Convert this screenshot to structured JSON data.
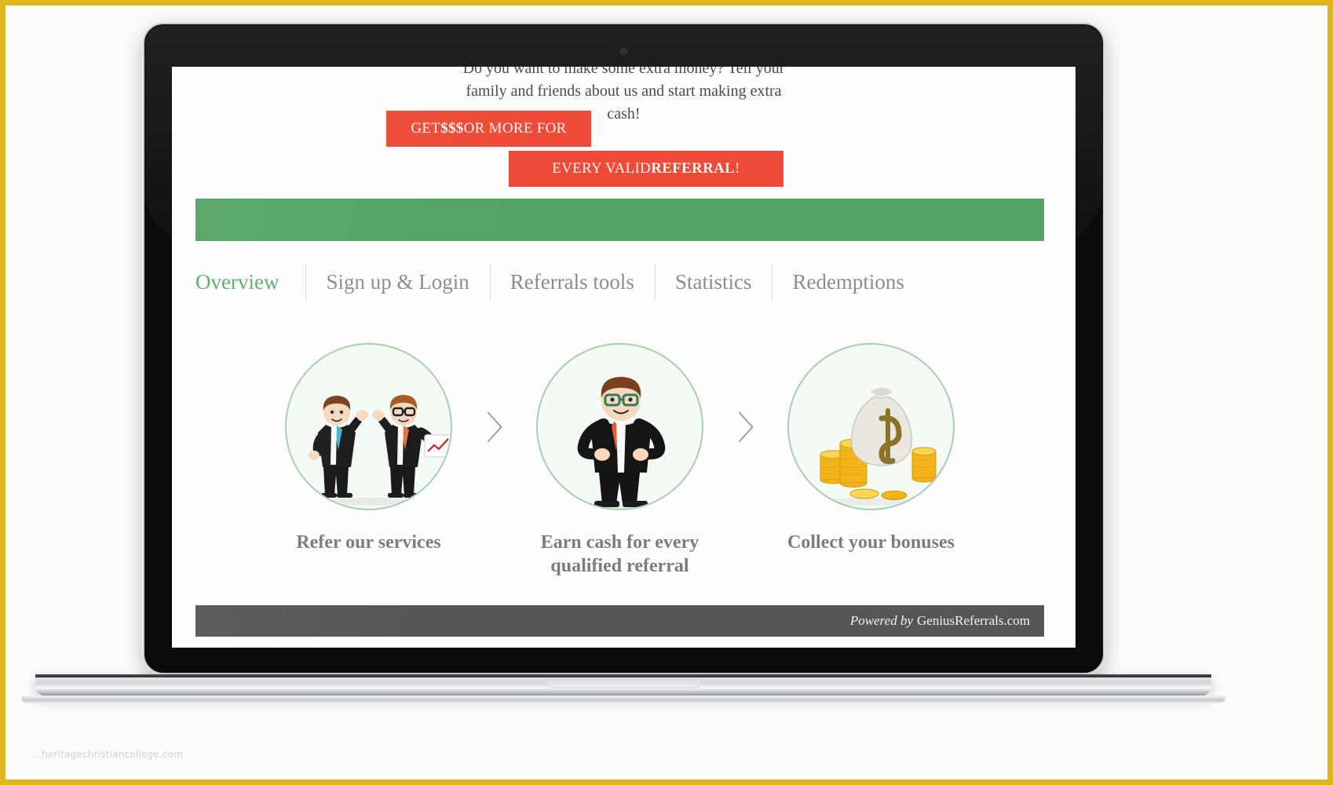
{
  "page": {
    "watermark": "...heritagechristiancollege.com",
    "border_color": "#e0b61e"
  },
  "intro": {
    "text": "Do you want to make some extra money? Tell your family and friends about us and start making extra cash!"
  },
  "ribbon": {
    "color": "#ee4a37",
    "fold_color": "#2e3033",
    "line1_prefix": "GET ",
    "line1_strong": "$$$",
    "line1_suffix": " OR MORE FOR",
    "line2_prefix": "EVERY VALID ",
    "line2_strong": "REFERRAL",
    "line2_suffix": "!"
  },
  "greenbar": {
    "color": "#55a365"
  },
  "tabs": {
    "active_color": "#5aad6b",
    "items": [
      {
        "label": "Overview",
        "active": true
      },
      {
        "label": "Sign up & Login",
        "active": false
      },
      {
        "label": "Referrals tools",
        "active": false
      },
      {
        "label": "Statistics",
        "active": false
      },
      {
        "label": "Redemptions",
        "active": false
      }
    ]
  },
  "steps": [
    {
      "icon": "two-businessmen-high-five-icon",
      "caption": "Refer our services"
    },
    {
      "icon": "confident-businessman-icon",
      "caption": "Earn cash for every qualified referral"
    },
    {
      "icon": "money-bag-and-coins-icon",
      "caption": "Collect your bonuses"
    }
  ],
  "separator": {
    "icon": "chevron-right-icon",
    "color": "#8aa694"
  },
  "footer": {
    "powered_by": "Powered by",
    "brand": "GeniusReferrals.com",
    "background": "#565656"
  }
}
